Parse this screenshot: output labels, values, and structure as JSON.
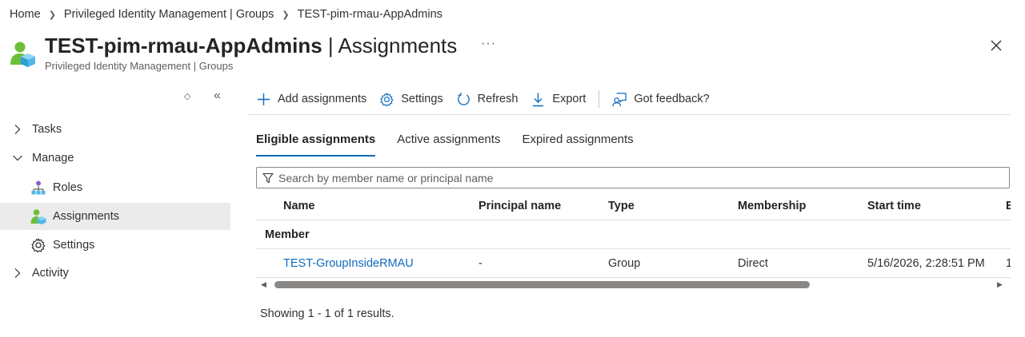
{
  "breadcrumb": [
    "Home",
    "Privileged Identity Management | Groups",
    "TEST-pim-rmau-AppAdmins"
  ],
  "header": {
    "title_bold": "TEST-pim-rmau-AppAdmins",
    "title_rest": " | Assignments",
    "subtitle": "Privileged Identity Management | Groups",
    "more": "···"
  },
  "sidebar": {
    "tools": {
      "collapse_up": "◇",
      "collapse_left": "«"
    },
    "items": [
      {
        "label": "Tasks",
        "kind": "group",
        "expanded": false
      },
      {
        "label": "Manage",
        "kind": "group",
        "expanded": true
      },
      {
        "label": "Roles",
        "kind": "child",
        "icon": "roles-icon"
      },
      {
        "label": "Assignments",
        "kind": "child",
        "icon": "assignments-icon",
        "active": true
      },
      {
        "label": "Settings",
        "kind": "child",
        "icon": "gear-icon"
      },
      {
        "label": "Activity",
        "kind": "group",
        "expanded": false
      }
    ]
  },
  "toolbar": {
    "add": "Add assignments",
    "settings": "Settings",
    "refresh": "Refresh",
    "export": "Export",
    "feedback": "Got feedback?"
  },
  "tabs": [
    {
      "label": "Eligible assignments",
      "active": true
    },
    {
      "label": "Active assignments",
      "active": false
    },
    {
      "label": "Expired assignments",
      "active": false
    }
  ],
  "search": {
    "placeholder": "Search by member name or principal name",
    "value": ""
  },
  "grid": {
    "columns": [
      "Name",
      "Principal name",
      "Type",
      "Membership",
      "Start time",
      "E"
    ],
    "group_label": "Member",
    "rows": [
      {
        "name": "TEST-GroupInsideRMAU",
        "principal": "-",
        "type": "Group",
        "membership": "Direct",
        "start": "5/16/2026, 2:28:51 PM",
        "end": "1"
      }
    ]
  },
  "results": "Showing 1 - 1 of 1 results.",
  "colors": {
    "accent": "#0f6cbd",
    "active_nav": "#ebebeb",
    "text": "#323130"
  }
}
